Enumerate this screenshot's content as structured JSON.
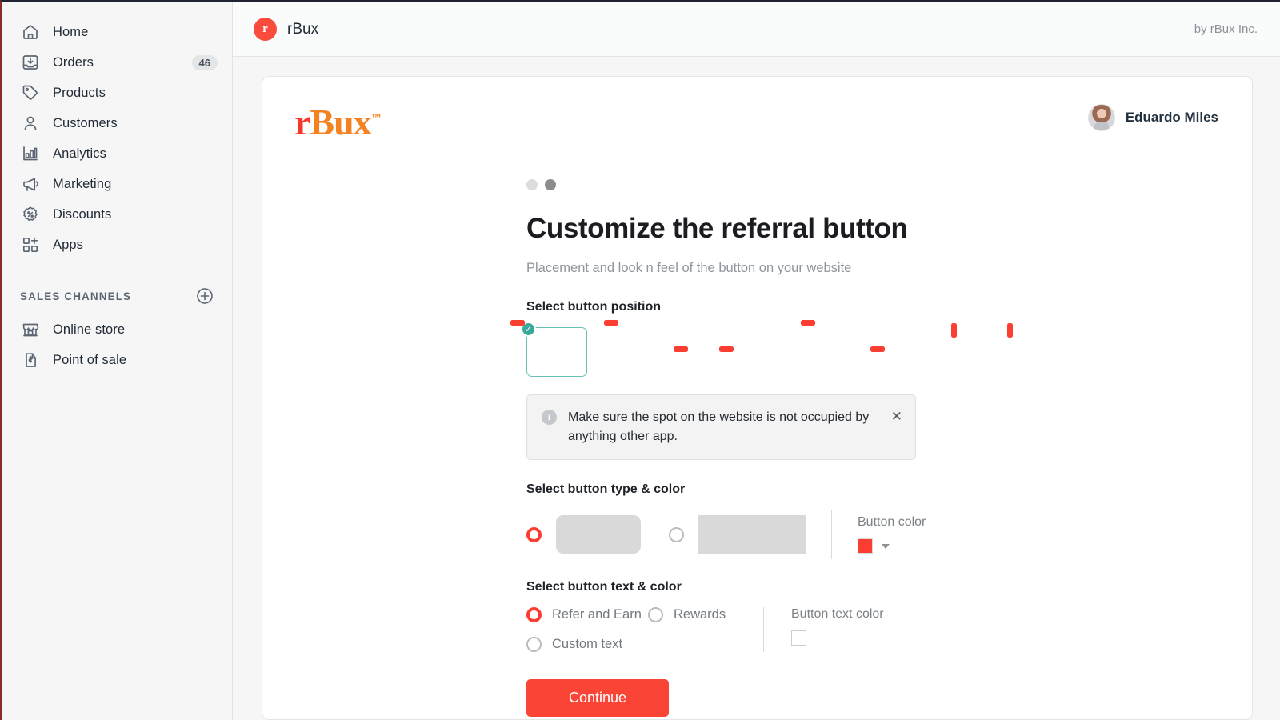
{
  "sidebar": {
    "items": [
      {
        "label": "Home",
        "icon": "home-icon",
        "badge": ""
      },
      {
        "label": "Orders",
        "icon": "orders-icon",
        "badge": "46"
      },
      {
        "label": "Products",
        "icon": "products-icon",
        "badge": ""
      },
      {
        "label": "Customers",
        "icon": "customers-icon",
        "badge": ""
      },
      {
        "label": "Analytics",
        "icon": "analytics-icon",
        "badge": ""
      },
      {
        "label": "Marketing",
        "icon": "marketing-icon",
        "badge": ""
      },
      {
        "label": "Discounts",
        "icon": "discounts-icon",
        "badge": ""
      },
      {
        "label": "Apps",
        "icon": "apps-icon",
        "badge": ""
      }
    ],
    "section_title": "SALES CHANNELS",
    "add_channel_icon": "plus-circle-icon",
    "channels": [
      {
        "label": "Online store",
        "icon": "store-icon"
      },
      {
        "label": "Point of sale",
        "icon": "point-of-sale-icon"
      }
    ]
  },
  "topbar": {
    "app_icon_glyph": "r",
    "app_name": "rBux",
    "byline": "by rBux Inc."
  },
  "card": {
    "brand": {
      "r": "r",
      "bux": "Bux",
      "tm": "™"
    },
    "user": {
      "name": "Eduardo Miles",
      "avatar": "user-avatar"
    }
  },
  "wizard": {
    "steps": [
      {
        "state": "inactive"
      },
      {
        "state": "active"
      }
    ],
    "title": "Customize the referral button",
    "subtitle": "Placement and look n feel of the button on your website",
    "position": {
      "label": "Select button position",
      "selected_index": 0,
      "options": [
        {
          "name": "bottom-right",
          "spot": "bottom-right",
          "orient": "h"
        },
        {
          "name": "bottom-left",
          "spot": "bottom-left",
          "orient": "h"
        },
        {
          "name": "top-left",
          "spot": "top-left",
          "orient": "h"
        },
        {
          "name": "top-right",
          "spot": "top-right",
          "orient": "h"
        },
        {
          "name": "bottom-center",
          "spot": "bottom-center",
          "orient": "h"
        },
        {
          "name": "top-center",
          "spot": "top-center",
          "orient": "h"
        },
        {
          "name": "left-middle",
          "spot": "left-middle",
          "orient": "v"
        },
        {
          "name": "right-middle",
          "spot": "right-middle",
          "orient": "v"
        }
      ]
    },
    "banner": {
      "icon": "info-icon",
      "text": "Make sure the spot on the website is not occupied by anything other app.",
      "close_icon": "close-icon"
    },
    "button_type": {
      "label": "Select button type & color",
      "selected_index": 0,
      "options": [
        {
          "name": "rounded-button-preview"
        },
        {
          "name": "square-button-preview"
        }
      ],
      "color_label": "Button color",
      "color_value": "#FA3F32"
    },
    "button_text": {
      "label": "Select button text & color",
      "selected_index": 0,
      "options": [
        {
          "label": "Refer and Earn"
        },
        {
          "label": "Rewards"
        },
        {
          "label": "Custom text"
        }
      ],
      "color_label": "Button text color",
      "color_value": "#FFFFFF"
    },
    "continue_label": "Continue"
  },
  "colors": {
    "accent_red": "#FA4436",
    "brand_orange": "#F58220",
    "brand_red": "#F6372C",
    "selected_teal": "#3AA99C"
  }
}
